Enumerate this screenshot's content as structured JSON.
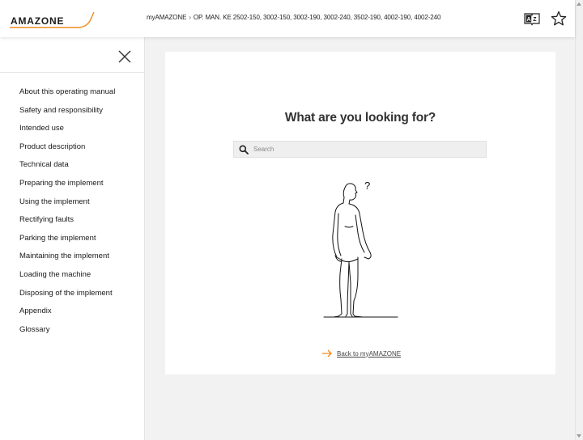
{
  "header": {
    "logo_text": "AMAZONE",
    "breadcrumb": {
      "home": "myAMAZONE",
      "separator": "›",
      "current": "OP. MAN. KE 2502-150, 3002-150, 3002-190, 3002-240, 3502-190, 4002-190, 4002-240"
    },
    "icons": [
      "glossary-icon",
      "favorite-star-icon"
    ]
  },
  "sidebar": {
    "items": [
      {
        "label": "About this operating manual"
      },
      {
        "label": "Safety and responsibility"
      },
      {
        "label": "Intended use"
      },
      {
        "label": "Product description"
      },
      {
        "label": "Technical data"
      },
      {
        "label": "Preparing the implement"
      },
      {
        "label": "Using the implement"
      },
      {
        "label": "Rectifying faults"
      },
      {
        "label": "Parking the implement"
      },
      {
        "label": "Maintaining the implement"
      },
      {
        "label": "Loading the machine"
      },
      {
        "label": "Disposing of the implement"
      },
      {
        "label": "Appendix"
      },
      {
        "label": "Glossary"
      }
    ]
  },
  "main": {
    "title": "What are you looking for?",
    "search": {
      "placeholder": "Search",
      "value": ""
    },
    "figure_question_mark": "?",
    "back_link": "Back to myAMAZONE"
  },
  "colors": {
    "brand_orange": "#f08a1c",
    "text_dark": "#222222",
    "panel_bg": "#ffffff",
    "page_bg": "#f2f2f2"
  }
}
